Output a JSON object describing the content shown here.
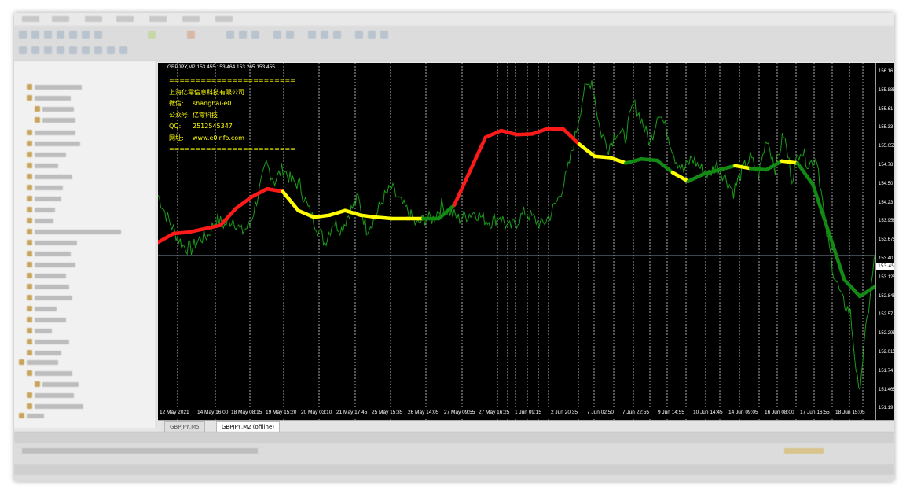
{
  "chart_window": {
    "header": "GBPJPY,M2  153.455 153.464 153.265 153.455"
  },
  "info_box": {
    "separator": "========================",
    "lines": [
      {
        "label": "",
        "value": "上海亿零信息科技有限公司"
      },
      {
        "label": "微信:",
        "value": "shanghai-e0"
      },
      {
        "label": "公众号:",
        "value": "亿零科技"
      },
      {
        "label": "QQ:",
        "value": "2512545347"
      },
      {
        "label": "网址:",
        "value": "www.e0info.com"
      }
    ]
  },
  "price_axis": {
    "labels": [
      "156.16",
      "155.885",
      "155.61",
      "155.33",
      "155.055",
      "154.78",
      "154.50",
      "154.23",
      "153.956",
      "153.675",
      "153.40",
      "153.125",
      "152.845",
      "152.57",
      "152.295",
      "152.015",
      "151.74",
      "151.465",
      "151.19"
    ],
    "current_price": "153.455"
  },
  "time_axis": {
    "labels": [
      "12 May 2021",
      "14 May 16:00",
      "18 May 08:15",
      "19 May 15:20",
      "20 May 03:10",
      "21 May 17:45",
      "25 May 15:35",
      "26 May 14:05",
      "27 May 09:55",
      "27 May 16:25",
      "1 Jun 09:15",
      "2 Jun 20:35",
      "7 Jun 02:50",
      "7 Jun 22:55",
      "9 Jun 14:55",
      "10 Jun 14:45",
      "14 Jun 09:05",
      "16 Jun 08:00",
      "17 Jun 16:55",
      "18 Jun 15:05"
    ]
  },
  "tabs": [
    {
      "label": "GBPJPY,M5",
      "active": false
    },
    {
      "label": "GBPJPY,M2 (offline)",
      "active": true
    }
  ],
  "chart_data": {
    "type": "line",
    "symbol": "GBPJPY",
    "timeframe": "M2",
    "ylim": [
      151.19,
      156.16
    ],
    "current_price_line": 153.455,
    "price_series": {
      "color": "#1a9c1a",
      "values": [
        154.35,
        154.05,
        153.8,
        153.6,
        153.55,
        153.7,
        153.75,
        154.0,
        153.9,
        154.0,
        153.8,
        153.9,
        154.35,
        154.8,
        154.55,
        154.75,
        154.55,
        154.5,
        154.15,
        153.9,
        153.65,
        153.95,
        153.85,
        154.1,
        154.3,
        153.85,
        154.0,
        154.3,
        154.45,
        154.25,
        154.1,
        153.9,
        154.0,
        154.0,
        154.2,
        154.1,
        154.0,
        154.05,
        154.1,
        154.0,
        153.95,
        154.05,
        153.85,
        153.95,
        154.1,
        154.0,
        153.9,
        154.05,
        154.3,
        154.65,
        155.2,
        155.85,
        156.05,
        155.3,
        155.05,
        155.3,
        155.2,
        155.7,
        155.45,
        155.1,
        155.6,
        155.3,
        154.9,
        154.7,
        154.9,
        154.75,
        154.65,
        154.8,
        154.6,
        154.4,
        154.7,
        154.9,
        154.65,
        155.2,
        154.75,
        155.25,
        154.6,
        155.05,
        154.8,
        154.9,
        153.9,
        153.2,
        152.8,
        152.6,
        151.4,
        152.5,
        153.5
      ]
    },
    "ma_series": {
      "values": [
        153.65,
        153.78,
        153.8,
        153.85,
        153.9,
        154.15,
        154.32,
        154.44,
        154.4,
        154.12,
        154.02,
        154.05,
        154.12,
        154.05,
        154.02,
        154.0,
        154.0,
        154.0,
        154.0,
        154.2,
        154.7,
        155.2,
        155.3,
        155.24,
        155.25,
        155.33,
        155.32,
        155.1,
        154.92,
        154.9,
        154.82,
        154.88,
        154.86,
        154.68,
        154.55,
        154.66,
        154.72,
        154.78,
        154.74,
        154.72,
        154.85,
        154.82,
        154.5,
        153.8,
        153.1,
        152.85,
        153.0
      ],
      "segment_colors": [
        "red",
        "red",
        "red",
        "red",
        "red",
        "red",
        "red",
        "red",
        "yellow",
        "yellow",
        "yellow",
        "yellow",
        "yellow",
        "yellow",
        "yellow",
        "yellow",
        "yellow",
        "green",
        "green",
        "red",
        "red",
        "red",
        "red",
        "red",
        "red",
        "red",
        "red",
        "yellow",
        "yellow",
        "yellow",
        "green",
        "green",
        "green",
        "yellow",
        "green",
        "green",
        "green",
        "yellow",
        "green",
        "green",
        "yellow",
        "green",
        "green",
        "green",
        "green",
        "green"
      ]
    },
    "grid": false
  }
}
